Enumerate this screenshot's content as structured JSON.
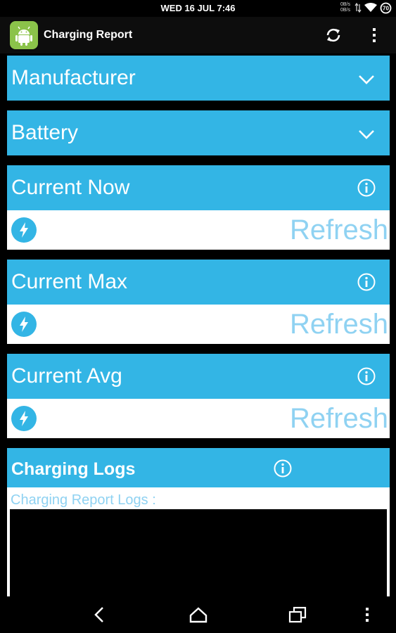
{
  "status_bar": {
    "clock": "WED 16 JUL 7:46",
    "speed_up": "0B/s",
    "speed_down": "0B/s",
    "battery_level": "70"
  },
  "action_bar": {
    "title": "Charging Report"
  },
  "sections": {
    "manufacturer": {
      "title": "Manufacturer"
    },
    "battery": {
      "title": "Battery"
    },
    "current_now": {
      "title": "Current Now",
      "action": "Refresh"
    },
    "current_max": {
      "title": "Current Max",
      "action": "Refresh"
    },
    "current_avg": {
      "title": "Current Avg",
      "action": "Refresh"
    },
    "logs": {
      "title": "Charging Logs",
      "label": "Charging Report Logs :"
    }
  },
  "colors": {
    "accent": "#33b5e5",
    "refresh_text": "#8fd2f2",
    "app_icon": "#8bc34a"
  }
}
